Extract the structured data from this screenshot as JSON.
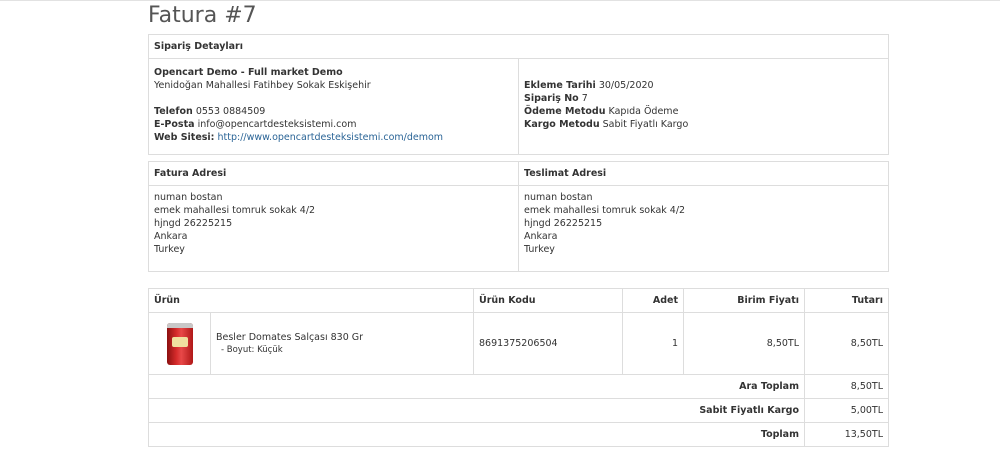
{
  "title": "Fatura #7",
  "order_details": {
    "heading": "Sipariş Detayları",
    "store_name": "Opencart Demo - Full market Demo",
    "store_address": "Yenidoğan Mahallesi Fatihbey Sokak Eskişehir",
    "phone_label": "Telefon",
    "phone": "0553 0884509",
    "email_label": "E-Posta",
    "email": "info@opencartdesteksistemi.com",
    "website_label": "Web Sitesi:",
    "website": "http://www.opencartdesteksistemi.com/demom",
    "date_added_label": "Ekleme Tarihi",
    "date_added": "30/05/2020",
    "order_no_label": "Sipariş No",
    "order_no": "7",
    "payment_method_label": "Ödeme Metodu",
    "payment_method": "Kapıda Ödeme",
    "shipping_method_label": "Kargo Metodu",
    "shipping_method": "Sabit Fiyatlı Kargo"
  },
  "addresses": {
    "payment_heading": "Fatura Adresi",
    "shipping_heading": "Teslimat Adresi",
    "payment_lines": [
      "numan bostan",
      "emek mahallesi tomruk sokak 4/2",
      "hjngd 26225215",
      "Ankara",
      "Turkey"
    ],
    "shipping_lines": [
      "numan bostan",
      "emek mahallesi tomruk sokak 4/2",
      "hjngd 26225215",
      "Ankara",
      "Turkey"
    ]
  },
  "products": {
    "headers": {
      "product": "Ürün",
      "model": "Ürün Kodu",
      "quantity": "Adet",
      "unit_price": "Birim Fiyatı",
      "total": "Tutarı"
    },
    "items": [
      {
        "name": "Besler Domates Salçası 830 Gr",
        "option": "- Boyut: Küçük",
        "model": "8691375206504",
        "quantity": "1",
        "unit_price": "8,50TL",
        "total": "8,50TL"
      }
    ],
    "totals": [
      {
        "label": "Ara Toplam",
        "value": "8,50TL"
      },
      {
        "label": "Sabit Fiyatlı Kargo",
        "value": "5,00TL"
      },
      {
        "label": "Toplam",
        "value": "13,50TL"
      }
    ]
  }
}
